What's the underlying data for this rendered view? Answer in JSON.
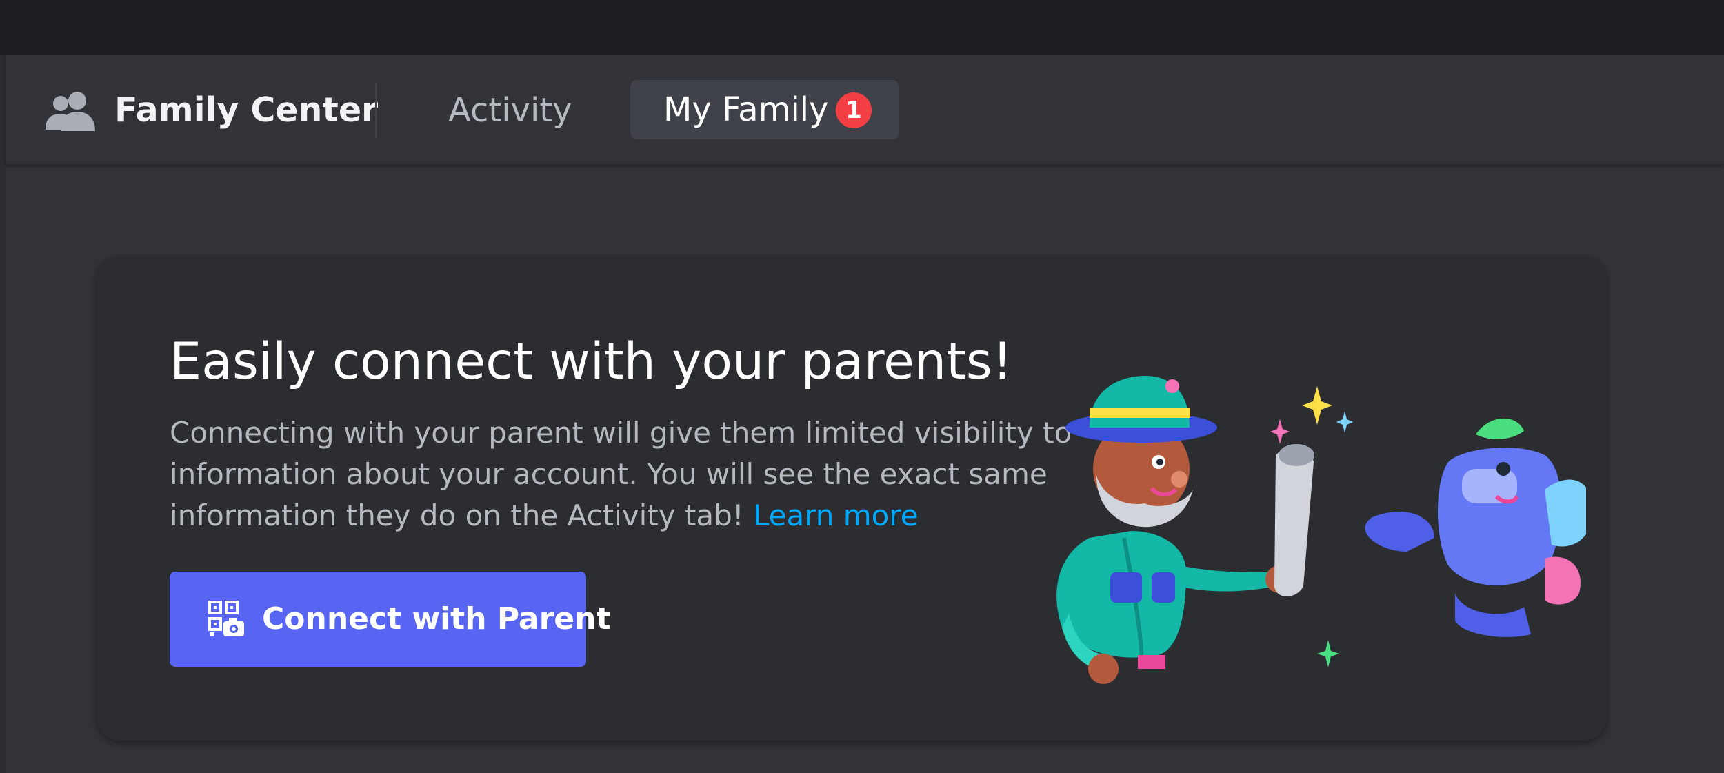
{
  "header": {
    "icon": "people-icon",
    "title": "Family Center",
    "tabs": [
      {
        "label": "Activity",
        "active": false
      },
      {
        "label": "My Family",
        "active": true,
        "badge": "1"
      }
    ]
  },
  "card": {
    "title": "Easily connect with your parents!",
    "body": "Connecting with your parent will give them limited visibility to information about your account. You will see the exact same information they do on the Activity tab!",
    "learn_more": "Learn more",
    "button": {
      "icon": "qr-camera-icon",
      "label": "Connect with Parent"
    },
    "illustration": "grandpa-and-discord-mascot-illustration"
  },
  "colors": {
    "accent": "#5865f2",
    "badge": "#f23f43",
    "link": "#00a8fc",
    "background": "#313338",
    "card": "#2b2d31"
  }
}
